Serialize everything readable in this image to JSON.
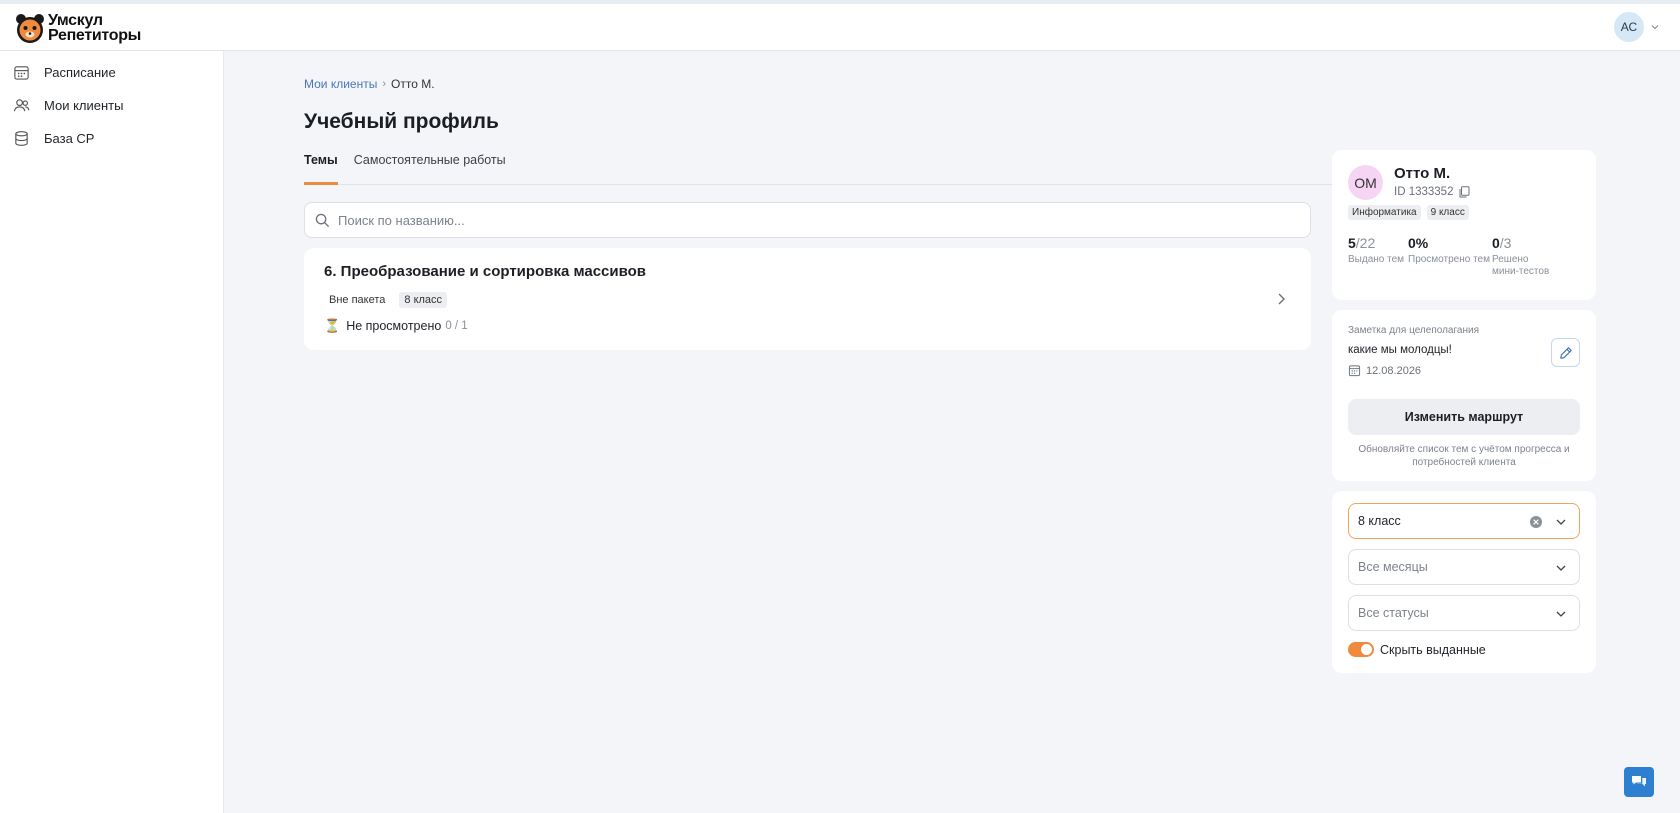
{
  "header": {
    "logo_line1": "Умскул",
    "logo_line2": "Репетиторы",
    "user_initials": "АС"
  },
  "sidebar": {
    "items": [
      {
        "label": "Расписание",
        "icon": "calendar-icon"
      },
      {
        "label": "Мои клиенты",
        "icon": "users-icon"
      },
      {
        "label": "База СР",
        "icon": "database-icon"
      }
    ]
  },
  "breadcrumb": {
    "parent": "Мои клиенты",
    "current": "Отто М."
  },
  "page": {
    "title": "Учебный профиль",
    "tabs": [
      {
        "label": "Темы",
        "active": true
      },
      {
        "label": "Самостоятельные работы",
        "active": false
      }
    ]
  },
  "search": {
    "placeholder": "Поиск по названию...",
    "value": ""
  },
  "topic": {
    "title": "6. Преобразование и сортировка массивов",
    "tags": [
      "Вне пакета",
      "8 класс"
    ],
    "status": "Не просмотрено",
    "count": "0 / 1"
  },
  "student": {
    "initials": "ОМ",
    "name": "Отто М.",
    "id": "ID 1333352",
    "tags": [
      "Информатика",
      "9 класс"
    ],
    "stats": [
      {
        "value": "5",
        "total": "/22",
        "label": "Выдано тем"
      },
      {
        "value": "0%",
        "total": "",
        "label": "Просмотрено тем"
      },
      {
        "value": "0",
        "total": "/3",
        "label": "Решено мини-тестов"
      }
    ]
  },
  "note": {
    "label": "Заметка для целеполагания",
    "text": "какие мы молодцы!",
    "date": "12.08.2026",
    "route_button": "Изменить маршрут",
    "route_hint": "Обновляйте список тем с учётом прогресса и потребностей клиента"
  },
  "filters": {
    "class_value": "8 класс",
    "months_placeholder": "Все месяцы",
    "status_placeholder": "Все статусы",
    "hide_issued_label": "Скрыть выданные",
    "hide_issued_on": true
  },
  "colors": {
    "accent": "#f08a3c",
    "link": "#4a77b4",
    "chat": "#2f7fd0"
  }
}
